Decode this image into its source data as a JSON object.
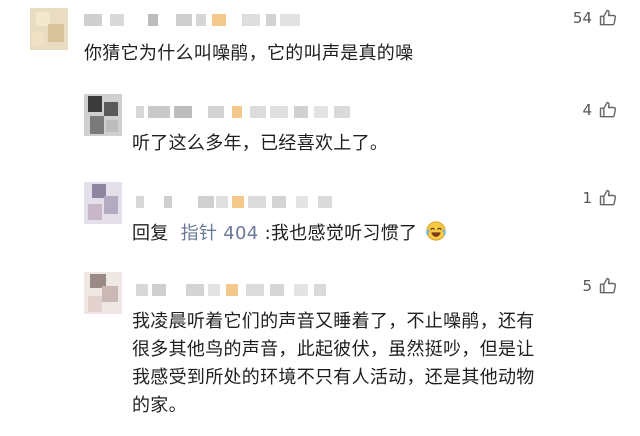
{
  "comments": [
    {
      "text": "你猜它为什么叫噪鹃，它的叫声是真的噪",
      "likes": "54",
      "like_icon": "thumbs-up-icon"
    },
    {
      "text": "听了这么多年，已经喜欢上了。",
      "likes": "4",
      "like_icon": "thumbs-up-icon"
    },
    {
      "reply_prefix": "回复",
      "reply_to": "指针 404",
      "reply_text": ":我也感觉听习惯了",
      "emoji": "laughing-tears-emoji",
      "likes": "1",
      "like_icon": "thumbs-up-icon"
    },
    {
      "text_lines": [
        "我凌晨听着它们的声音又睡着了，不止噪鹃，还有",
        "很多其他鸟的声音，此起彼伏，虽然挺吵，但是让",
        "我感受到所处的环境不只有人活动，还是其他动物",
        "的家。"
      ],
      "likes": "5",
      "like_icon": "thumbs-up-icon"
    }
  ],
  "colors": {
    "background": "#ffffff",
    "text": "#1f1f1f",
    "mention": "#6b7a99",
    "like_count": "#555555",
    "blur_gray": "#c9c9c9",
    "blur_orange": "#f2c98a"
  }
}
